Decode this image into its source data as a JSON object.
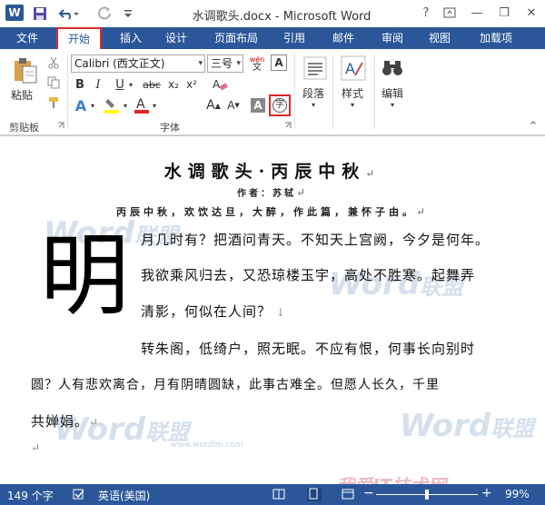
{
  "window": {
    "title": "水调歌头.docx - Microsoft Word",
    "help": "?",
    "min": "—",
    "restore": "❐",
    "close": "✕",
    "app_badge": "W"
  },
  "tabs": {
    "file": "文件",
    "home": "开始",
    "insert": "插入",
    "design": "设计",
    "layout": "页面布局",
    "references": "引用",
    "mailings": "邮件",
    "review": "审阅",
    "view": "视图",
    "addins": "加载项"
  },
  "ribbon": {
    "paste": "粘贴",
    "clipboard": "剪贴板",
    "font": "字体",
    "font_name": "Calibri (西文正文)",
    "font_size": "三号",
    "paragraph": "段落",
    "styles": "样式",
    "editing": "编辑",
    "wen": "wén",
    "char_btn": "字",
    "bold": "B",
    "italic": "I",
    "underline": "U",
    "strike": "abc",
    "sub": "x₂",
    "sup": "x²"
  },
  "doc": {
    "title": "水调歌头·丙辰中秋",
    "author": "作者：苏轼",
    "preface": "丙辰中秋，欢饮达旦，大醉，作此篇，兼怀子由。",
    "dropcap": "明",
    "lines": [
      "月几时有？把酒问青天。不知天上宫阙，今夕是何年。",
      "我欲乘风归去，又恐琼楼玉宇，高处不胜寒。起舞弄",
      "清影，何似在人间？",
      "转朱阁，低绮户，照无眠。不应有恨，何事长向别时",
      "圆？人有悲欢离合，月有阴晴圆缺，此事古难全。但愿人长久，千里",
      "共婵娟。"
    ]
  },
  "watermark": {
    "word": "Word",
    "lm": "联盟",
    "url": "www.wordlm.com",
    "site": "我爱IT技术网"
  },
  "status": {
    "words": "149 个字",
    "lang": "英语(美国)",
    "zoom": "99%"
  }
}
